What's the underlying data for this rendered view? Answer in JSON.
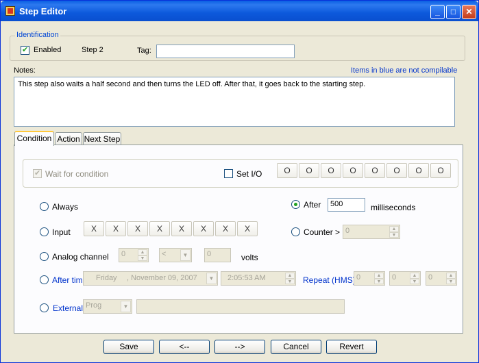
{
  "window": {
    "title": "Step Editor",
    "controls": {
      "minimize": "_",
      "maximize": "□",
      "close": "✕"
    }
  },
  "identification": {
    "legend": "Identification",
    "enabled_label": "Enabled",
    "enabled_checked": true,
    "step_label": "Step 2",
    "tag_label": "Tag:",
    "tag_value": ""
  },
  "notes": {
    "label": "Notes:",
    "hint": "Items in blue are not compilable",
    "text": "This step also waits a half second and then turns the LED off. After that, it goes back to the starting step."
  },
  "tabs": [
    {
      "label": "Condition",
      "active": true
    },
    {
      "label": "Action",
      "active": false
    },
    {
      "label": "Next Step",
      "active": false
    }
  ],
  "condition": {
    "wait_for_condition_label": "Wait for condition",
    "wait_for_condition_checked": true,
    "set_io_label": "Set I/O",
    "set_io_checked": false,
    "io_bits": [
      "O",
      "O",
      "O",
      "O",
      "O",
      "O",
      "O",
      "O"
    ],
    "always_label": "Always",
    "input_label": "Input",
    "input_bits": [
      "X",
      "X",
      "X",
      "X",
      "X",
      "X",
      "X",
      "X"
    ],
    "analog_label": "Analog channel",
    "analog_channel_value": "0",
    "analog_op_value": "<",
    "analog_volts_value": "0",
    "volts_label": "volts",
    "after_time_label": "After time",
    "date_day": "Friday",
    "date_rest": ", November 09, 2007",
    "time_value": "2:05:53 AM",
    "repeat_label": "Repeat (HMS):",
    "repeat_h": "0",
    "repeat_m": "0",
    "repeat_s": "0",
    "external_label": "External",
    "external_select": "Prog",
    "external_value": "",
    "after_label": "After",
    "after_checked": true,
    "after_value": "500",
    "milliseconds_label": "milliseconds",
    "counter_label": "Counter >",
    "counter_value": "0"
  },
  "buttons": {
    "save": "Save",
    "back": "<--",
    "forward": "-->",
    "cancel": "Cancel",
    "revert": "Revert"
  }
}
